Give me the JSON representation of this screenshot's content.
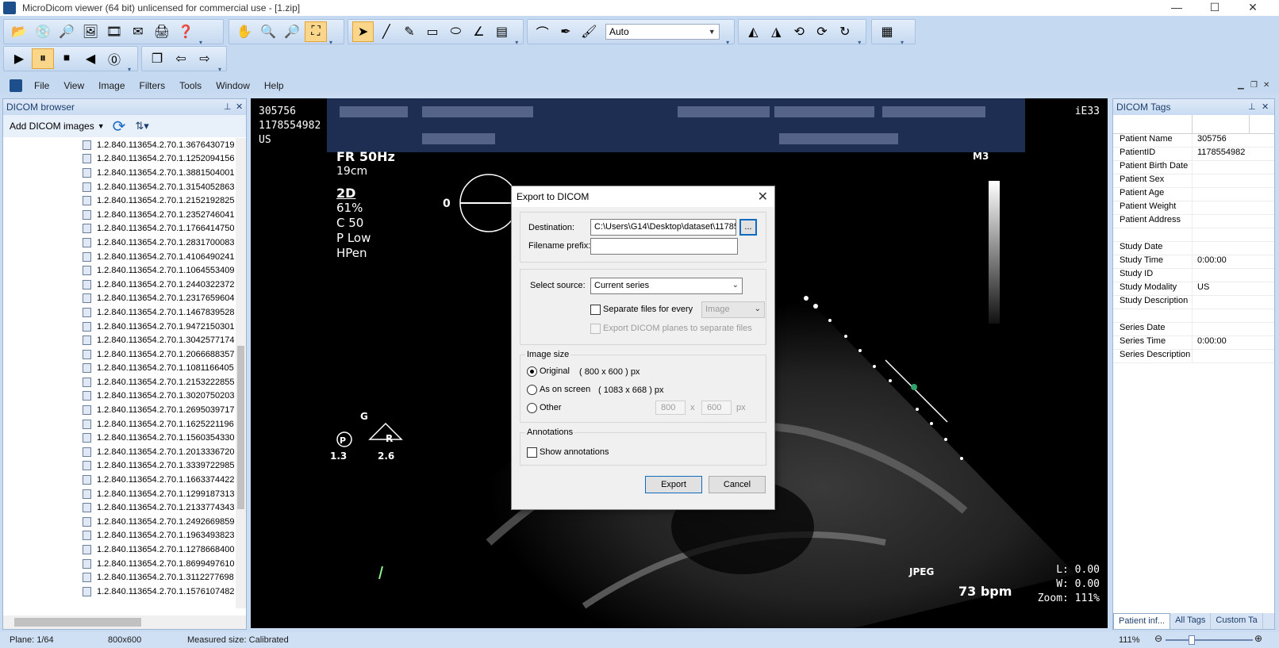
{
  "window": {
    "title": "MicroDicom viewer (64 bit) unlicensed for commercial use - [1.zip]",
    "minimize": "—",
    "maximize": "☐",
    "close": "✕"
  },
  "toolbar": {
    "window_level_preset": "Auto"
  },
  "menu": [
    "File",
    "View",
    "Image",
    "Filters",
    "Tools",
    "Window",
    "Help"
  ],
  "browser": {
    "title": "DICOM browser",
    "add_label": "Add DICOM images",
    "items": [
      "1.2.840.113654.2.70.1.3676430719",
      "1.2.840.113654.2.70.1.1252094156",
      "1.2.840.113654.2.70.1.3881504001",
      "1.2.840.113654.2.70.1.3154052863",
      "1.2.840.113654.2.70.1.2152192825",
      "1.2.840.113654.2.70.1.2352746041",
      "1.2.840.113654.2.70.1.1766414750",
      "1.2.840.113654.2.70.1.2831700083",
      "1.2.840.113654.2.70.1.4106490241",
      "1.2.840.113654.2.70.1.1064553409",
      "1.2.840.113654.2.70.1.2440322372",
      "1.2.840.113654.2.70.1.2317659604",
      "1.2.840.113654.2.70.1.1467839528",
      "1.2.840.113654.2.70.1.9472150301",
      "1.2.840.113654.2.70.1.3042577174",
      "1.2.840.113654.2.70.1.2066688357",
      "1.2.840.113654.2.70.1.1081166405",
      "1.2.840.113654.2.70.1.2153222855",
      "1.2.840.113654.2.70.1.3020750203",
      "1.2.840.113654.2.70.1.2695039717",
      "1.2.840.113654.2.70.1.1625221196",
      "1.2.840.113654.2.70.1.1560354330",
      "1.2.840.113654.2.70.1.2013336720",
      "1.2.840.113654.2.70.1.3339722985",
      "1.2.840.113654.2.70.1.1663374422",
      "1.2.840.113654.2.70.1.1299187313",
      "1.2.840.113654.2.70.1.2133774343",
      "1.2.840.113654.2.70.1.2492669859",
      "1.2.840.113654.2.70.1.1963493823",
      "1.2.840.113654.2.70.1.1278668400",
      "1.2.840.113654.2.70.1.8699497610",
      "1.2.840.113654.2.70.1.3112277698",
      "1.2.840.113654.2.70.1.1576107482"
    ]
  },
  "viewer": {
    "top_left": [
      "305756",
      "1178554982",
      "US"
    ],
    "top_right": "iE33",
    "us_params": [
      "FR 50Hz",
      "19cm",
      "2D",
      " 61%",
      "C 50",
      "P Low",
      "HPen"
    ],
    "probe_marker": "0",
    "m3": "M3",
    "jpeg": "JPEG",
    "bpm": "73 bpm",
    "level": "L: 0.00",
    "width": "W: 0.00",
    "zoom": "Zoom: 111%",
    "gpr": {
      "g": "G",
      "p": "P",
      "r": "R",
      "left": "1.3",
      "right": "2.6"
    }
  },
  "dialog": {
    "title": "Export to DICOM",
    "destination_label": "Destination:",
    "destination_value": "C:\\Users\\G14\\Desktop\\dataset\\1178554982",
    "browse_label": "...",
    "prefix_label": "Filename prefix:",
    "prefix_value": "",
    "select_source_label": "Select source:",
    "select_source_value": "Current series",
    "separate_label": "Separate files for every",
    "separate_value": "Image",
    "planes_label": "Export DICOM planes to separate files",
    "image_size_label": "Image size",
    "original_label": "Original",
    "original_size": "( 800 x 600 ) px",
    "onscreen_label": "As on screen",
    "onscreen_size": "( 1083 x 668 ) px",
    "other_label": "Other",
    "other_w": "800",
    "other_x": "x",
    "other_h": "600",
    "other_px": "px",
    "annotations_label": "Annotations",
    "show_annotations_label": "Show annotations",
    "export_label": "Export",
    "cancel_label": "Cancel"
  },
  "tags": {
    "title": "DICOM Tags",
    "rows": [
      [
        "Patient Name",
        "305756"
      ],
      [
        "PatientID",
        "1178554982"
      ],
      [
        "Patient Birth Date",
        ""
      ],
      [
        "Patient Sex",
        ""
      ],
      [
        "Patient Age",
        ""
      ],
      [
        "Patient Weight",
        ""
      ],
      [
        "Patient Address",
        ""
      ],
      [
        "",
        ""
      ],
      [
        "Study Date",
        ""
      ],
      [
        "Study Time",
        "0:00:00"
      ],
      [
        "Study ID",
        ""
      ],
      [
        "Study Modality",
        "US"
      ],
      [
        "Study Description",
        ""
      ],
      [
        "",
        ""
      ],
      [
        "Series Date",
        ""
      ],
      [
        "Series Time",
        "0:00:00"
      ],
      [
        "Series Description",
        ""
      ]
    ],
    "tabs": [
      "Patient inf...",
      "All Tags",
      "Custom Ta"
    ]
  },
  "status": {
    "plane": "Plane: 1/64",
    "size": "800x600",
    "measured": "Measured size: Calibrated",
    "zoom": "111%",
    "zoom_level_percent": 111
  }
}
